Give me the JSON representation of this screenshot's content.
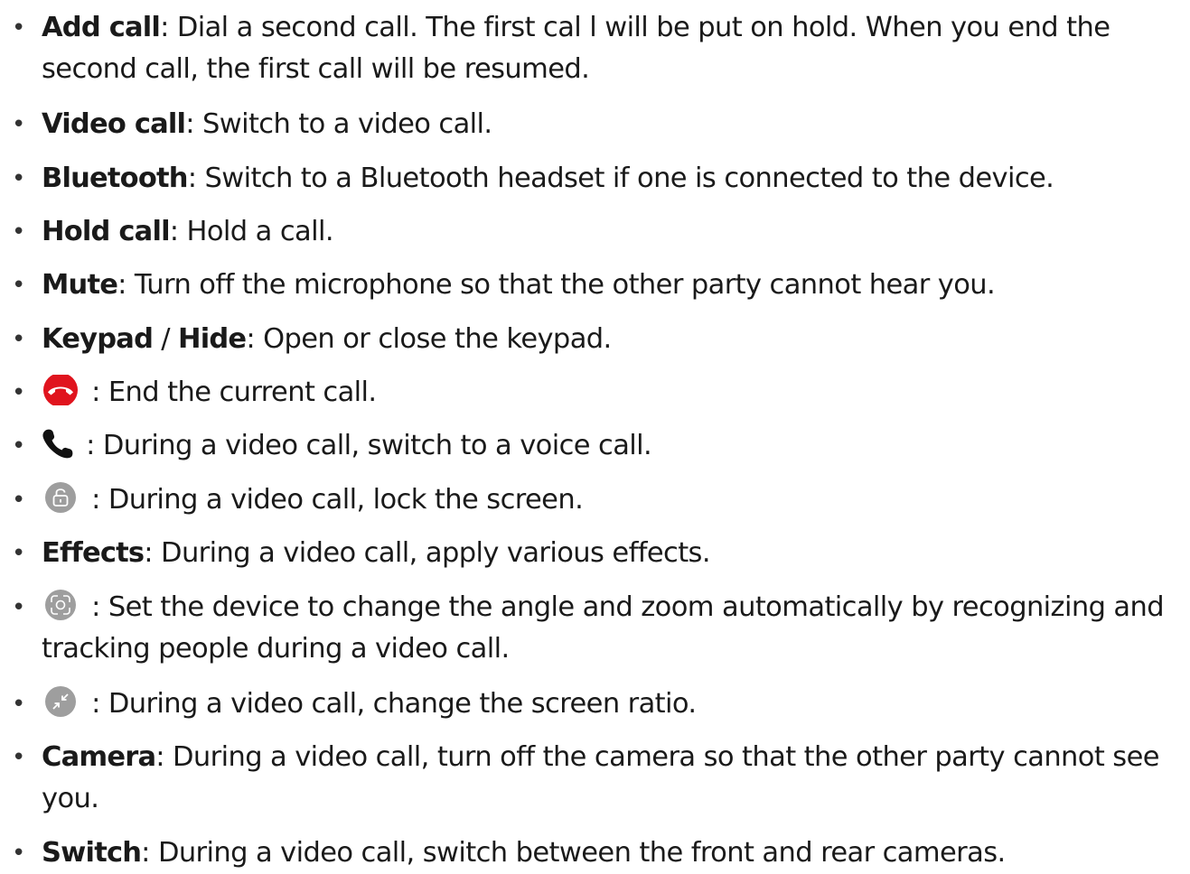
{
  "items": [
    {
      "term": "Add call",
      "desc": ": Dial a second call. The first cal  l will be put on hold. When you end the second call, the first call will be resumed."
    },
    {
      "term": "Video call",
      "desc": ": Switch to a video call."
    },
    {
      "term": "Bluetooth",
      "desc": ": Switch to a Bluetooth headset if one is connected to the device."
    },
    {
      "term": "Hold call",
      "desc": ": Hold a call."
    },
    {
      "term": "Mute",
      "desc": ": Turn off the microphone so that the other party cannot hear you."
    },
    {
      "term": "Keypad",
      "sep": " / ",
      "term2": "Hide",
      "desc": ": Open or close the keypad."
    },
    {
      "icon": "end-call-icon",
      "desc": " : End the current call."
    },
    {
      "icon": "voice-call-icon",
      "desc": " : During a video call, switch to a voice call."
    },
    {
      "icon": "lock-screen-icon",
      "desc": " : During a video call, lock the screen."
    },
    {
      "term": "Effects",
      "desc": ": During a video call, apply various effects."
    },
    {
      "icon": "auto-framing-icon",
      "desc": " : Set the device to change the angle and zoom automatically by recognizing and tracking people during a video call."
    },
    {
      "icon": "screen-ratio-icon",
      "desc": " : During a video call, change the screen ratio."
    },
    {
      "term": "Camera",
      "desc": ": During a video call, turn off the camera so that the other party cannot see you."
    },
    {
      "term": "Switch",
      "desc": ": During a video call, switch between the front and rear cameras."
    }
  ],
  "colors": {
    "end_call_red": "#e0141e",
    "icon_gray": "#9e9e9e",
    "text": "#1a1a1a"
  }
}
